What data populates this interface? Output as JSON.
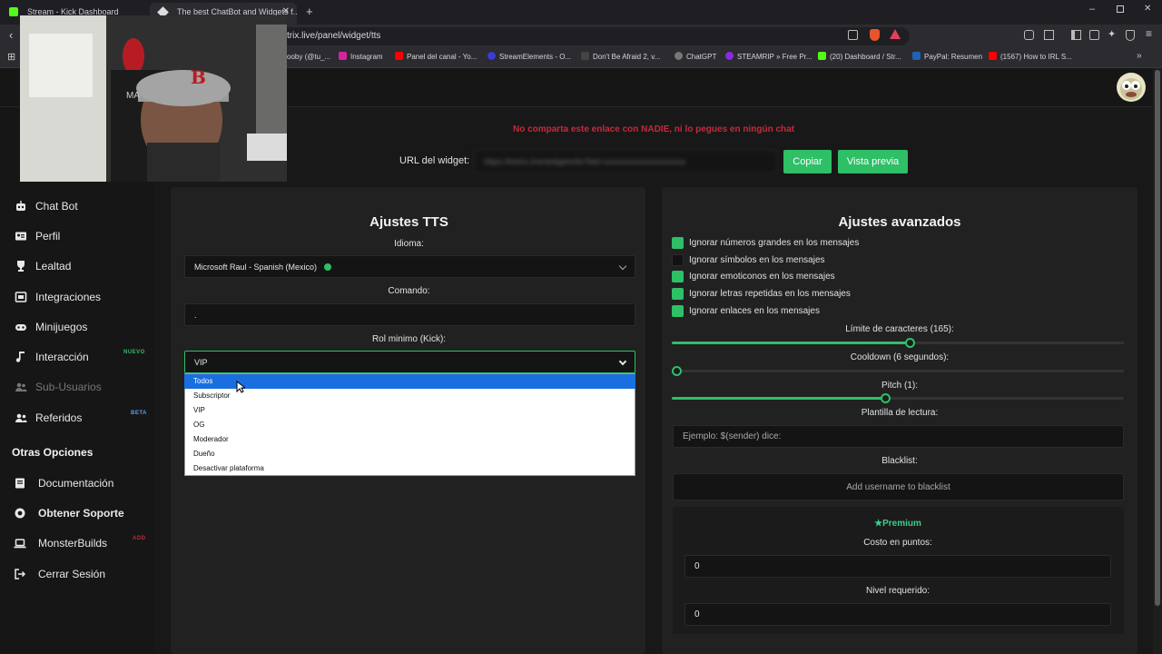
{
  "browser": {
    "tabs": [
      {
        "title": "Stream - Kick Dashboard"
      },
      {
        "title": "The best ChatBot and Widgets f..."
      }
    ],
    "url": "trix.live/panel/widget/tts",
    "bookmarks": [
      {
        "label": "oobу (@tu_..."
      },
      {
        "label": "Instagram"
      },
      {
        "label": "Panel del canal - Yo..."
      },
      {
        "label": "StreamElements - O..."
      },
      {
        "label": "Don't Be Afraid 2, v..."
      },
      {
        "label": "ChatGPT"
      },
      {
        "label": "STEAMRIP » Free Pr..."
      },
      {
        "label": "(20) Dashboard / Str..."
      },
      {
        "label": "PayPal: Resumen"
      },
      {
        "label": "(1567) How to IRL S..."
      }
    ]
  },
  "webcam": {
    "cap_text": "MA"
  },
  "sidebar": {
    "items": [
      {
        "label": "Chat Bot",
        "icon": "robot-icon"
      },
      {
        "label": "Perfil",
        "icon": "id-card-icon"
      },
      {
        "label": "Lealtad",
        "icon": "trophy-icon"
      },
      {
        "label": "Integraciones",
        "icon": "plug-icon"
      },
      {
        "label": "Minijuegos",
        "icon": "gamepad-icon"
      },
      {
        "label": "Interacción",
        "icon": "music-icon",
        "badge": "NUEVO"
      },
      {
        "label": "Sub-Usuarios",
        "icon": "users-icon"
      },
      {
        "label": "Referidos",
        "icon": "user-plus-icon",
        "badge": "BETA"
      }
    ],
    "section_title": "Otras Opciones",
    "other_items": [
      {
        "label": "Documentación",
        "icon": "book-icon"
      },
      {
        "label": "Obtener Soporte",
        "icon": "support-icon"
      },
      {
        "label": "MonsterBuilds",
        "icon": "laptop-icon",
        "badge": "ADD"
      },
      {
        "label": "Cerrar Sesión",
        "icon": "logout-icon"
      }
    ]
  },
  "warning": "No comparta este enlace con NADIE, ni lo pegues en ningún chat",
  "widget_url": {
    "label": "URL del widget:",
    "value": "https://botrix.live/widgets/tts?bid=xxxxxxxxxxxxxxxxxxxx",
    "copy_label": "Copiar",
    "preview_label": "Vista previa"
  },
  "tts": {
    "title": "Ajustes TTS",
    "language_label": "Idioma:",
    "language_value": "Microsoft Raul - Spanish (Mexico)",
    "command_label": "Comando:",
    "command_value": ".",
    "role_label": "Rol minimo (Kick):",
    "role_value": "VIP",
    "role_options": [
      "Todos",
      "Subscriptor",
      "VIP",
      "OG",
      "Moderador",
      "Dueño",
      "Desactivar plataforma"
    ],
    "highlighted_option": "Todos"
  },
  "advanced": {
    "title": "Ajustes avanzados",
    "checkboxes": [
      {
        "label": "Ignorar números grandes en los mensajes",
        "checked": true
      },
      {
        "label": "Ignorar símbolos en los mensajes",
        "checked": false
      },
      {
        "label": "Ignorar emoticonos en los mensajes",
        "checked": true
      },
      {
        "label": "Ignorar letras repetidas en los mensajes",
        "checked": true
      },
      {
        "label": "Ignorar enlaces en los mensajes",
        "checked": true
      }
    ],
    "char_limit_label": "Límite de caracteres (165):",
    "char_limit_value": 165,
    "cooldown_label": "Cooldown (6 segundos):",
    "cooldown_value": 6,
    "pitch_label": "Pitch (1):",
    "pitch_value": 1,
    "template_label": "Plantilla de lectura:",
    "template_placeholder": "Ejemplo: $(sender) dice:",
    "blacklist_label": "Blacklist:",
    "blacklist_placeholder": "Add username to blacklist",
    "premium_label": "Premium",
    "cost_label": "Costo en puntos:",
    "cost_value": "0",
    "level_label": "Nivel requerido:",
    "level_value": "0"
  },
  "colors": {
    "accent": "#2fbf67",
    "warning": "#c8283a",
    "highlight": "#1a6fe0"
  }
}
